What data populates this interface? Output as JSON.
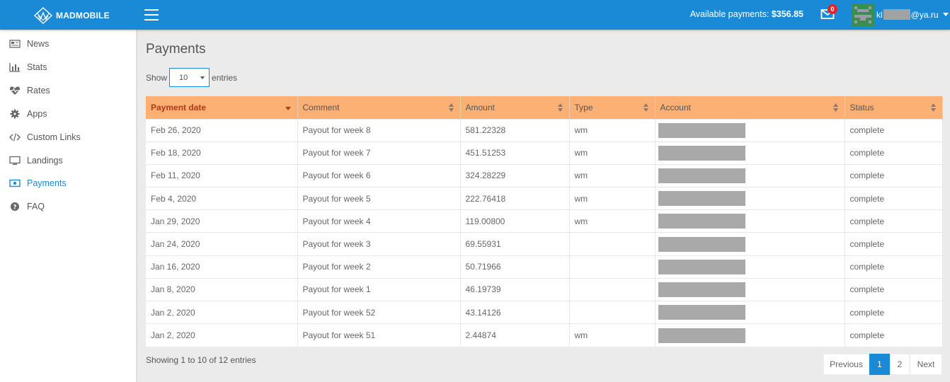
{
  "header": {
    "logo_text": "MADMOBILE",
    "available_label": "Available payments:",
    "available_amount": "$356.85",
    "mail_count": "0",
    "user_prefix": "kl",
    "user_suffix": "@ya.ru"
  },
  "sidebar": {
    "items": [
      {
        "label": "News",
        "icon": "newspaper-icon"
      },
      {
        "label": "Stats",
        "icon": "bar-chart-icon"
      },
      {
        "label": "Rates",
        "icon": "heartbeat-icon"
      },
      {
        "label": "Apps",
        "icon": "gear-icon"
      },
      {
        "label": "Custom Links",
        "icon": "code-icon"
      },
      {
        "label": "Landings",
        "icon": "monitor-icon"
      },
      {
        "label": "Payments",
        "icon": "money-icon"
      },
      {
        "label": "FAQ",
        "icon": "question-circle-icon"
      }
    ],
    "active": "Payments"
  },
  "page": {
    "title": "Payments",
    "show_label": "Show",
    "entries_value": "10",
    "entries_label": "entries"
  },
  "table": {
    "columns": [
      "Payment date",
      "Comment",
      "Amount",
      "Type",
      "Account",
      "Status"
    ],
    "rows": [
      {
        "date": "Feb 26, 2020",
        "comment": "Payout for week 8",
        "amount": "581.22328",
        "type": "wm",
        "status": "complete"
      },
      {
        "date": "Feb 18, 2020",
        "comment": "Payout for week 7",
        "amount": "451.51253",
        "type": "wm",
        "status": "complete"
      },
      {
        "date": "Feb 11, 2020",
        "comment": "Payout for week 6",
        "amount": "324.28229",
        "type": "wm",
        "status": "complete"
      },
      {
        "date": "Feb 4, 2020",
        "comment": "Payout for week 5",
        "amount": "222.76418",
        "type": "wm",
        "status": "complete"
      },
      {
        "date": "Jan 29, 2020",
        "comment": "Payout for week 4",
        "amount": "119.00800",
        "type": "wm",
        "status": "complete"
      },
      {
        "date": "Jan 24, 2020",
        "comment": "Payout for week 3",
        "amount": "69.55931",
        "type": "",
        "status": "complete"
      },
      {
        "date": "Jan 16, 2020",
        "comment": "Payout for week 2",
        "amount": "50.71966",
        "type": "",
        "status": "complete"
      },
      {
        "date": "Jan 8, 2020",
        "comment": "Payout for week 1",
        "amount": "46.19739",
        "type": "",
        "status": "complete"
      },
      {
        "date": "Jan 2, 2020",
        "comment": "Payout for week 52",
        "amount": "43.14126",
        "type": "",
        "status": "complete"
      },
      {
        "date": "Jan 2, 2020",
        "comment": "Payout for week 51",
        "amount": "2.44874",
        "type": "wm",
        "status": "complete"
      }
    ]
  },
  "footer": {
    "showing": "Showing 1 to 10 of 12 entries",
    "prev": "Previous",
    "page1": "1",
    "page2": "2",
    "next": "Next"
  },
  "colors": {
    "topbar": "#1a8ad6",
    "table_header": "#fcb074",
    "sorted_header_text": "#b23a17",
    "active_nav": "#1a8ad6"
  }
}
